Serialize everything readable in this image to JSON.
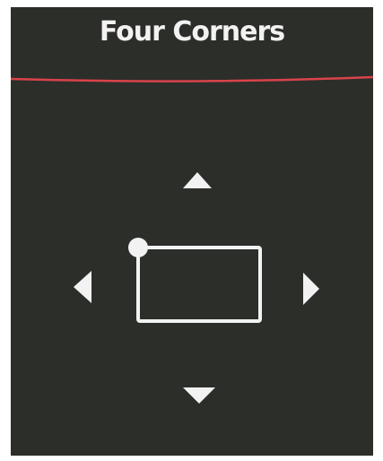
{
  "header": {
    "title": "Four Corners"
  },
  "colors": {
    "screen_bg": "#2c2e2a",
    "divider": "#d9434b",
    "foreground": "#f2f2f2"
  },
  "controls": {
    "up_icon": "triangle-up-icon",
    "down_icon": "triangle-down-icon",
    "left_icon": "triangle-left-icon",
    "right_icon": "triangle-right-icon",
    "corner_preview_icon": "rectangle-with-corner-dot-icon"
  }
}
